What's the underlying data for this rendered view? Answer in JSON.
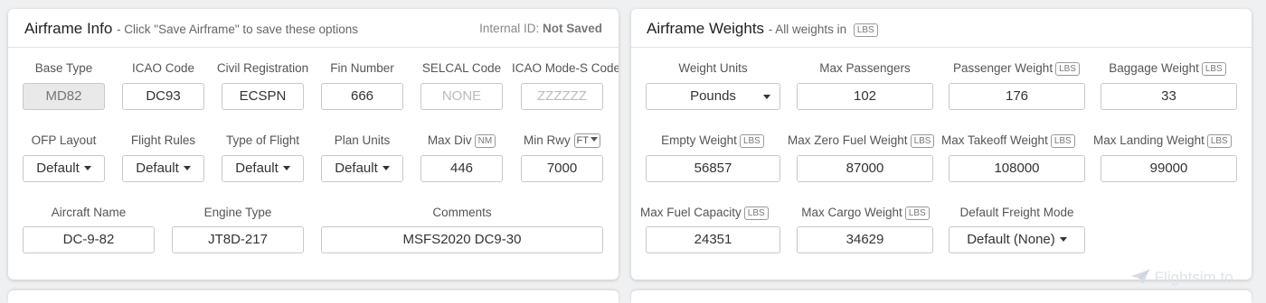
{
  "airframe_info": {
    "title": "Airframe Info",
    "subtitle": "- Click \"Save Airframe\" to save these options",
    "internal_id_label": "Internal ID:",
    "internal_id_value": "Not Saved",
    "fields": {
      "base_type": {
        "label": "Base Type",
        "value": "MD82"
      },
      "icao_code": {
        "label": "ICAO Code",
        "value": "DC93"
      },
      "civil_registration": {
        "label": "Civil Registration",
        "value": "ECSPN"
      },
      "fin_number": {
        "label": "Fin Number",
        "value": "666"
      },
      "selcal_code": {
        "label": "SELCAL Code",
        "placeholder": "NONE"
      },
      "icao_mode_s": {
        "label": "ICAO Mode-S Code",
        "placeholder": "ZZZZZZ"
      },
      "ofp_layout": {
        "label": "OFP Layout",
        "value": "Default"
      },
      "flight_rules": {
        "label": "Flight Rules",
        "value": "Default"
      },
      "type_of_flight": {
        "label": "Type of Flight",
        "value": "Default"
      },
      "plan_units": {
        "label": "Plan Units",
        "value": "Default"
      },
      "max_div": {
        "label": "Max Div",
        "unit": "NM",
        "value": "446"
      },
      "min_rwy": {
        "label": "Min Rwy",
        "unit": "FT",
        "value": "7000"
      },
      "aircraft_name": {
        "label": "Aircraft Name",
        "value": "DC-9-82"
      },
      "engine_type": {
        "label": "Engine Type",
        "value": "JT8D-217"
      },
      "comments": {
        "label": "Comments",
        "value": "MSFS2020 DC9-30"
      }
    }
  },
  "airframe_weights": {
    "title": "Airframe Weights",
    "subtitle": "- All weights in",
    "unit": "LBS",
    "fields": {
      "weight_units": {
        "label": "Weight Units",
        "value": "Pounds"
      },
      "max_passengers": {
        "label": "Max Passengers",
        "value": "102"
      },
      "passenger_weight": {
        "label": "Passenger Weight",
        "unit": "LBS",
        "value": "176"
      },
      "baggage_weight": {
        "label": "Baggage Weight",
        "unit": "LBS",
        "value": "33"
      },
      "empty_weight": {
        "label": "Empty Weight",
        "unit": "LBS",
        "value": "56857"
      },
      "max_zero_fuel_weight": {
        "label": "Max Zero Fuel Weight",
        "unit": "LBS",
        "value": "87000"
      },
      "max_takeoff_weight": {
        "label": "Max Takeoff Weight",
        "unit": "LBS",
        "value": "108000"
      },
      "max_landing_weight": {
        "label": "Max Landing Weight",
        "unit": "LBS",
        "value": "99000"
      },
      "max_fuel_capacity": {
        "label": "Max Fuel Capacity",
        "unit": "LBS",
        "value": "24351"
      },
      "max_cargo_weight": {
        "label": "Max Cargo Weight",
        "unit": "LBS",
        "value": "34629"
      },
      "default_freight_mode": {
        "label": "Default Freight Mode",
        "value": "Default (None)"
      }
    }
  },
  "watermark": {
    "text": "Flightsim.to",
    "icon": "paper-plane-icon"
  }
}
